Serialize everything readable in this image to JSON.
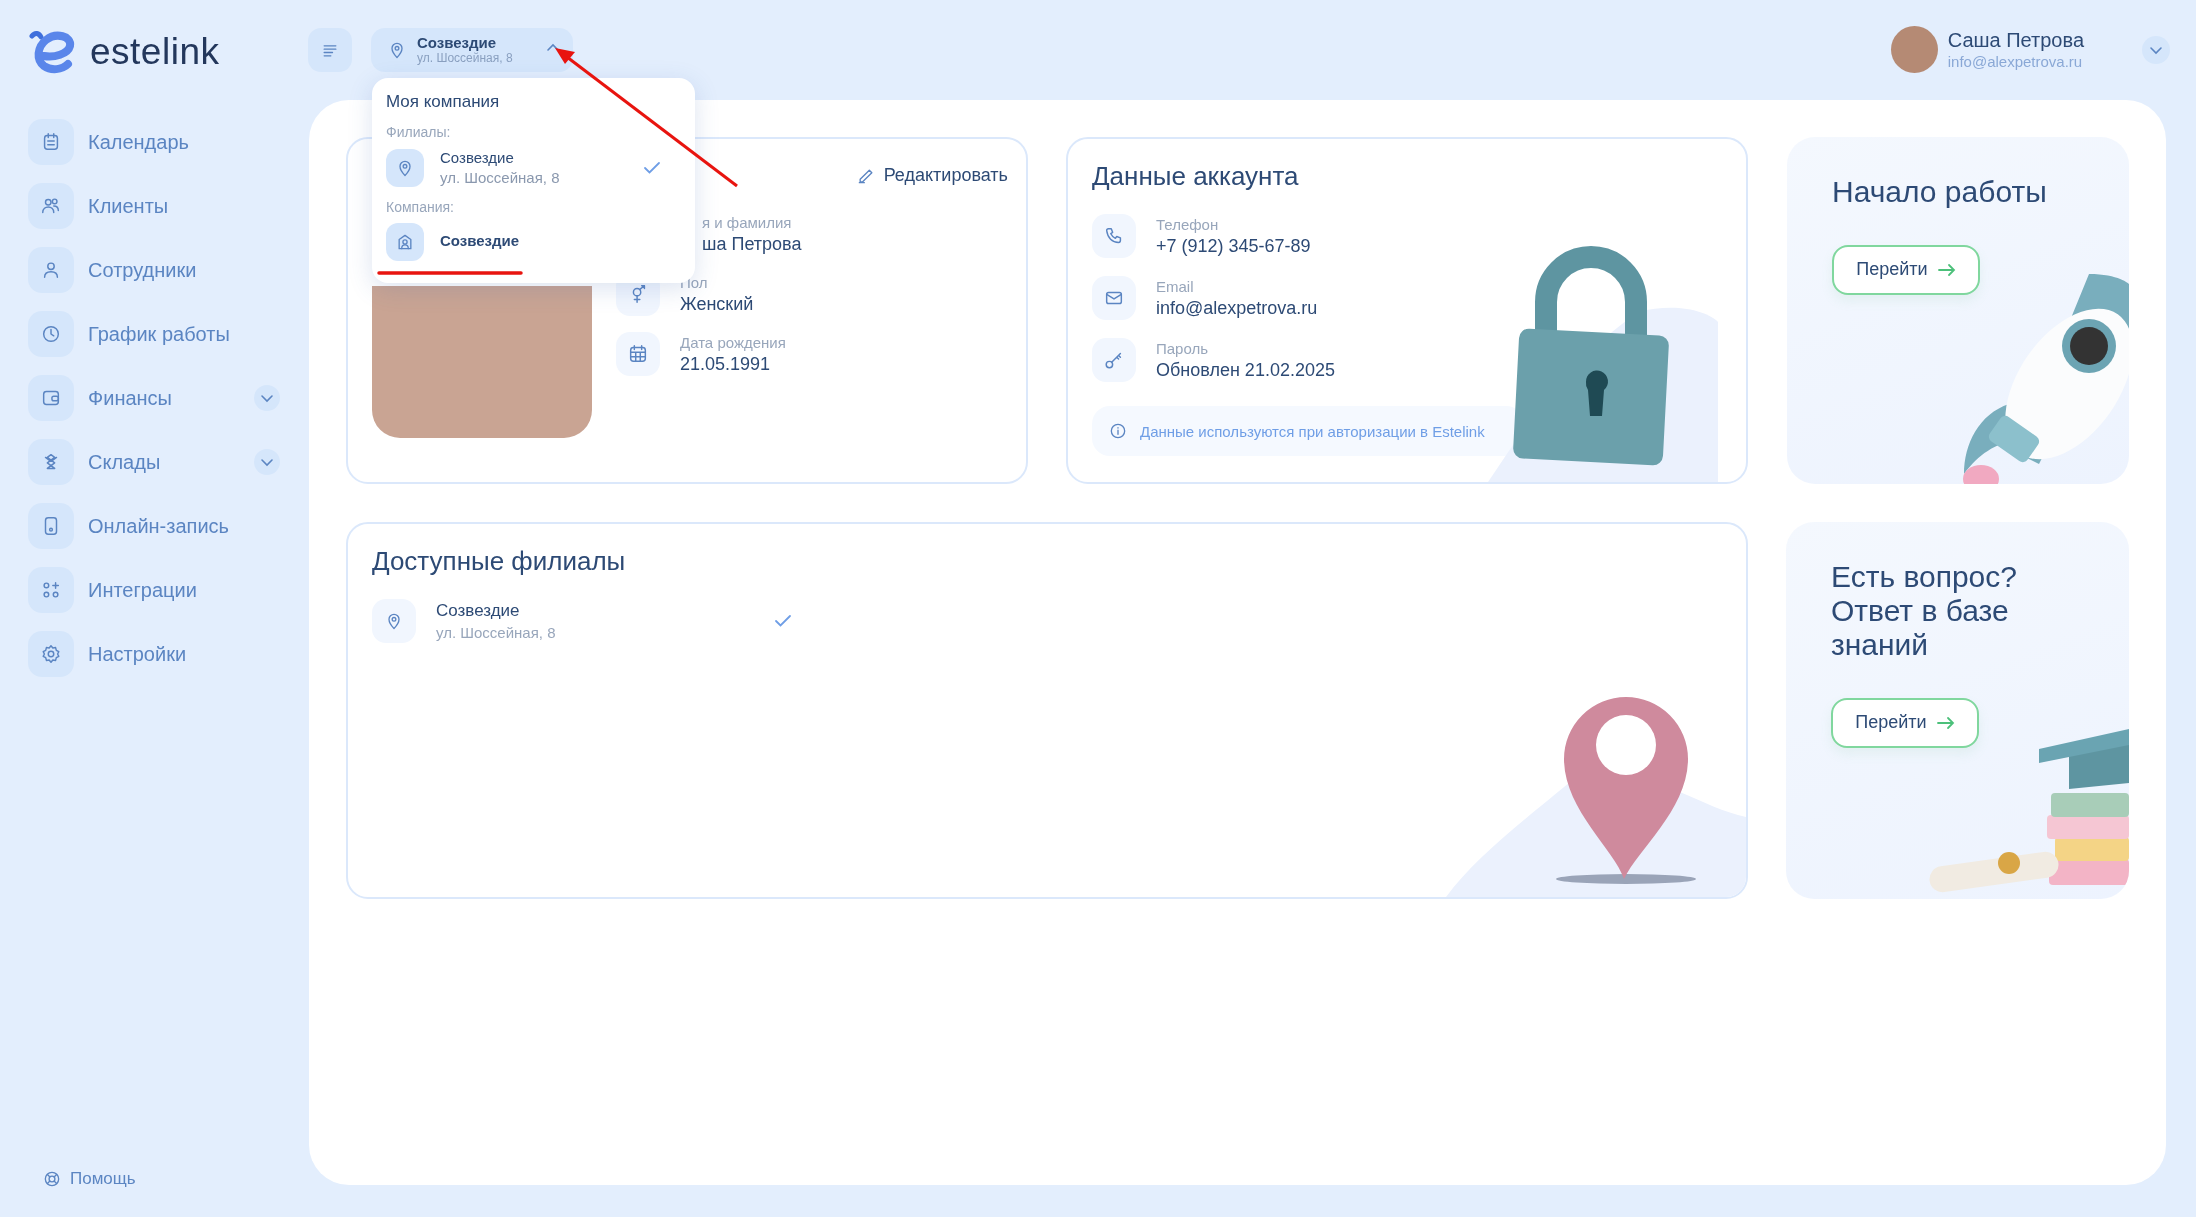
{
  "logo": {
    "text": "estelink"
  },
  "sidebar": {
    "items": [
      {
        "kind": "calendar",
        "label": "Календарь",
        "expandable": false
      },
      {
        "kind": "clients",
        "label": "Клиенты",
        "expandable": false
      },
      {
        "kind": "staff",
        "label": "Сотрудники",
        "expandable": false
      },
      {
        "kind": "schedule",
        "label": "График работы",
        "expandable": false
      },
      {
        "kind": "finance",
        "label": "Финансы",
        "expandable": true
      },
      {
        "kind": "stock",
        "label": "Склады",
        "expandable": true
      },
      {
        "kind": "booking",
        "label": "Онлайн-запись",
        "expandable": false
      },
      {
        "kind": "integrations",
        "label": "Интеграции",
        "expandable": false
      },
      {
        "kind": "settings",
        "label": "Настройки",
        "expandable": false
      }
    ],
    "help": "Помощь"
  },
  "header": {
    "location": {
      "name": "Созвездие",
      "address": "ул. Шоссейная, 8",
      "expanded": true
    },
    "user": {
      "name": "Саша Петрова",
      "email": "info@alexpetrova.ru"
    }
  },
  "dropdown": {
    "title": "Моя компания",
    "branches_label": "Филиалы:",
    "branches": [
      {
        "name": "Созвездие",
        "address": "ул. Шоссейная, 8",
        "selected": true
      }
    ],
    "company_label": "Компания:",
    "company": {
      "name": "Созвездие"
    }
  },
  "profile": {
    "edit": "Редактировать",
    "fields": [
      {
        "kind": "name",
        "label": "я и фамилия",
        "value": "ша Петрова"
      },
      {
        "kind": "gender",
        "label": "Пол",
        "value": "Женский"
      },
      {
        "kind": "birthday",
        "label": "Дата рождения",
        "value": "21.05.1991"
      }
    ]
  },
  "account": {
    "title": "Данные аккаунта",
    "fields": [
      {
        "kind": "phone",
        "label": "Телефон",
        "value": "+7 (912) 345-67-89"
      },
      {
        "kind": "email",
        "label": "Email",
        "value": "info@alexpetrova.ru"
      },
      {
        "kind": "password",
        "label": "Пароль",
        "value": "Обновлен 21.02.2025"
      }
    ],
    "note": "Данные используются при авторизации в Estelink"
  },
  "branches": {
    "title": "Доступные филиалы",
    "items": [
      {
        "name": "Созвездие",
        "address": "ул. Шоссейная, 8",
        "selected": true
      }
    ]
  },
  "promos": [
    {
      "kind": "rocket",
      "title": "Начало работы",
      "button": "Перейти"
    },
    {
      "kind": "books",
      "title": "Есть вопрос? Ответ в базе знаний",
      "button": "Перейти"
    }
  ]
}
